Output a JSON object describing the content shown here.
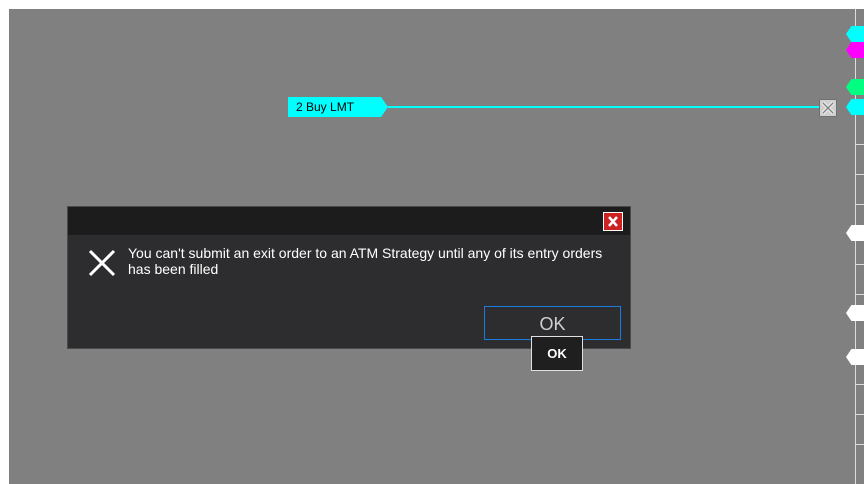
{
  "order": {
    "label": "2  Buy LMT",
    "line_color": "#00ffff"
  },
  "dialog": {
    "message": "You can't submit an exit order to an ATM Strategy until any of its entry orders has been filled",
    "ok_label": "OK",
    "close_icon": "close-icon",
    "error_icon": "x-icon"
  },
  "tooltip": {
    "text": "OK"
  },
  "price_markers": [
    {
      "color": "#00ffff"
    },
    {
      "color": "#ff00ff"
    },
    {
      "color": "#00ff80"
    },
    {
      "color": "#00ffff"
    },
    {
      "color": "#ffffff"
    },
    {
      "color": "#ffffff"
    },
    {
      "color": "#ffffff"
    }
  ],
  "colors": {
    "chart_background": "#808080",
    "dialog_background": "#2d2d2f",
    "ok_border": "#1a7ae0"
  }
}
